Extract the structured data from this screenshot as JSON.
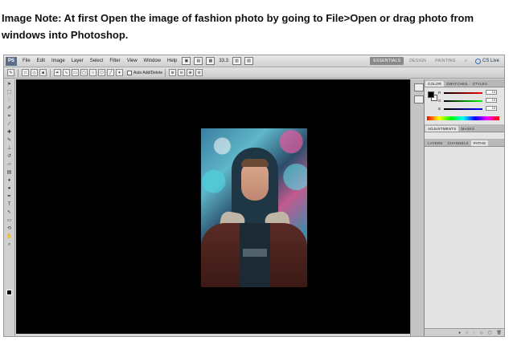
{
  "note": {
    "text": "Image Note: At first Open the image of fashion photo by going to File>Open or drag photo from windows into Photoshop."
  },
  "app": {
    "logo": "PS",
    "menu": [
      "File",
      "Edit",
      "Image",
      "Layer",
      "Select",
      "Filter",
      "View",
      "Window",
      "Help"
    ],
    "zoom": "33.3",
    "workspaces": [
      {
        "label": "ESSENTIALS",
        "active": true
      },
      {
        "label": "DESIGN",
        "active": false
      },
      {
        "label": "PAINTING",
        "active": false
      }
    ],
    "more": "»",
    "cs_live": "CS Live"
  },
  "options": {
    "auto_add_delete": "Auto Add/Delete"
  },
  "panels": {
    "color_tabs": [
      "COLOR",
      "SWATCHES",
      "STYLES"
    ],
    "color_values": {
      "r_label": "R",
      "g_label": "G",
      "b_label": "B",
      "r": "10",
      "g": "10",
      "b": "10"
    },
    "adjust_tabs": [
      "ADJUSTMENTS",
      "MASKS"
    ],
    "layer_tabs": [
      "LAYERS",
      "CHANNELS",
      "PATHS"
    ],
    "active_layer_tab": "PATHS"
  },
  "colors": {
    "canvas": "#000000",
    "foreground": "#000000",
    "background": "#ffffff"
  }
}
